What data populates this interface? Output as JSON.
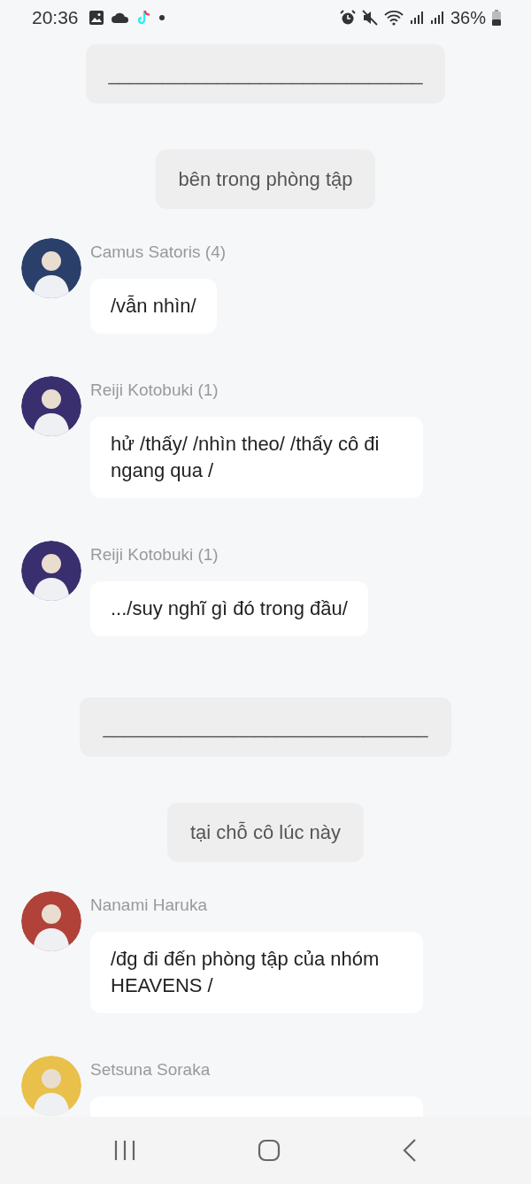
{
  "status_bar": {
    "time": "20:36",
    "battery": "36%"
  },
  "chat": [
    {
      "kind": "narration",
      "text": "_____________________________"
    },
    {
      "kind": "narration",
      "text": "bên trong phòng tập"
    },
    {
      "kind": "message",
      "name": "Camus Satoris (4)",
      "text": "/vẫn nhìn/"
    },
    {
      "kind": "message",
      "name": "Reiji Kotobuki (1)",
      "text": "hử /thấy/ /nhìn theo/ /thấy cô đi ngang qua /"
    },
    {
      "kind": "message",
      "name": "Reiji Kotobuki (1)",
      "text": ".../suy nghĩ gì đó trong đầu/"
    },
    {
      "kind": "narration",
      "text": "______________________________"
    },
    {
      "kind": "narration",
      "text": "tại chỗ cô lúc này"
    },
    {
      "kind": "message",
      "name": "Nanami Haruka",
      "text": "/đg đi đến phòng tập của nhóm HEAVENS /"
    },
    {
      "kind": "message",
      "name": "Setsuna Soraka"
    }
  ]
}
